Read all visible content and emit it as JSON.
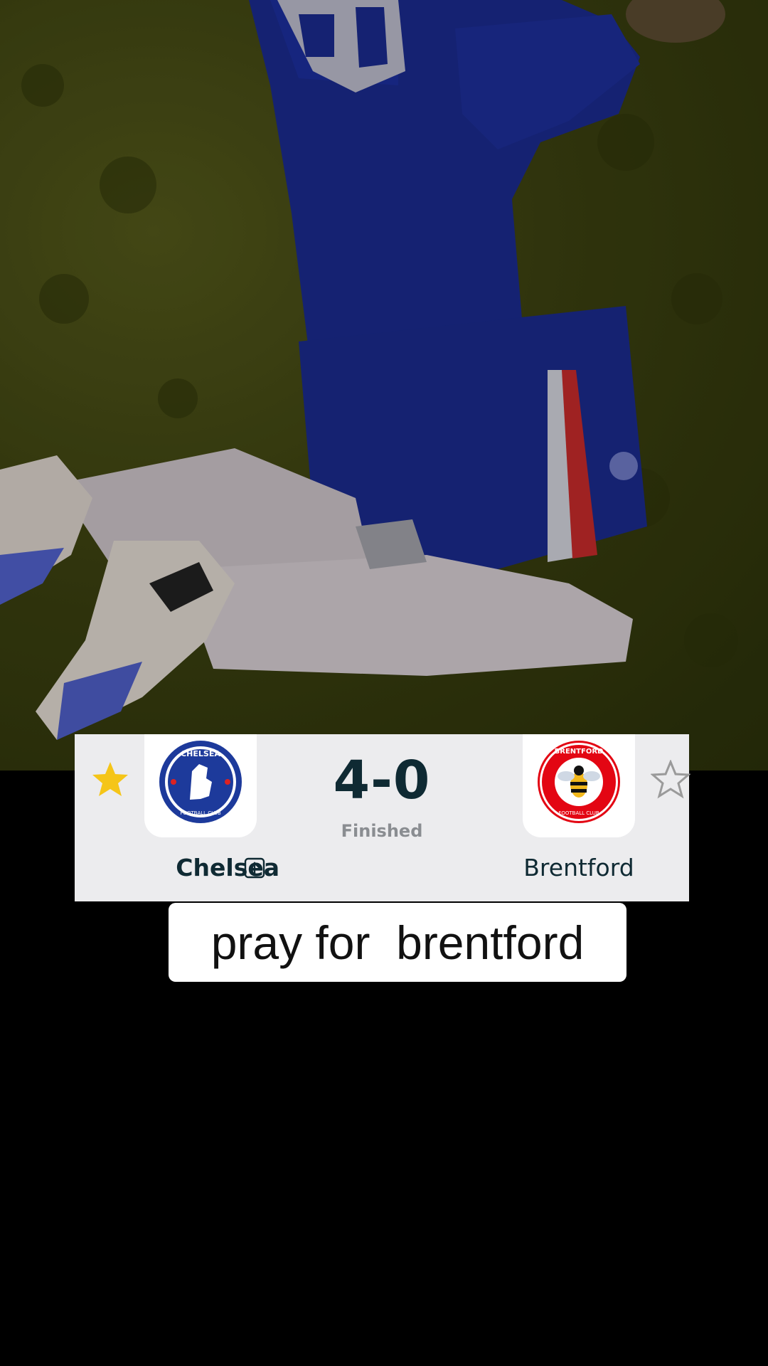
{
  "match": {
    "home_team": "Chelsea",
    "away_team": "Brentford",
    "score": "4-0",
    "status": "Finished",
    "home_favorited": true,
    "away_favorited": false,
    "home_crest_icon": "chelsea-crest",
    "away_crest_icon": "brentford-crest",
    "home_crest_text": {
      "top": "CHELSEA",
      "bottom": "FOOTBALL CLUB"
    },
    "away_crest_text": {
      "top": "BRENTFORD",
      "bottom": "FOOTBALL CLUB"
    },
    "colors": {
      "star_active": "#f5c518",
      "star_inactive": "#9a9a9a",
      "score_text": "#0f2a33",
      "status_text": "#8a8d91",
      "card_bg": "#ececee"
    }
  },
  "caption": {
    "text": "pray for  brentford"
  }
}
